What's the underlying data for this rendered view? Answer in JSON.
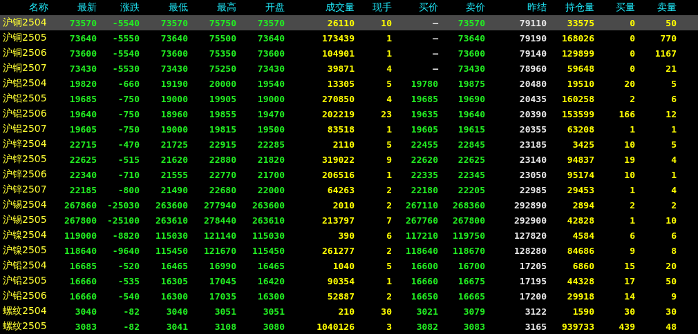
{
  "columns": [
    {
      "label": "名称",
      "kind": "name"
    },
    {
      "label": "最新",
      "kind": "price"
    },
    {
      "label": "涨跌",
      "kind": "price"
    },
    {
      "label": "最低",
      "kind": "price"
    },
    {
      "label": "最高",
      "kind": "price"
    },
    {
      "label": "开盘",
      "kind": "price"
    },
    {
      "label": "成交量",
      "kind": "volume"
    },
    {
      "label": "现手",
      "kind": "volume"
    },
    {
      "label": "买价",
      "kind": "price"
    },
    {
      "label": "卖价",
      "kind": "price"
    },
    {
      "label": "昨结",
      "kind": "settle"
    },
    {
      "label": "持仓量",
      "kind": "volume"
    },
    {
      "label": "买量",
      "kind": "volume"
    },
    {
      "label": "卖量",
      "kind": "volume"
    }
  ],
  "rows": [
    {
      "selected": true,
      "cells": [
        "沪铜2504",
        "73570",
        "-5540",
        "73570",
        "75750",
        "73570",
        "26110",
        "10",
        {
          "text": "—",
          "kind": "empty"
        },
        "73570",
        "79110",
        "33575",
        "0",
        "50"
      ]
    },
    {
      "selected": false,
      "cells": [
        "沪铜2505",
        "73640",
        "-5550",
        "73640",
        "75500",
        "73640",
        "173439",
        "1",
        {
          "text": "—",
          "kind": "empty"
        },
        "73640",
        "79190",
        "168026",
        "0",
        "770"
      ]
    },
    {
      "selected": false,
      "cells": [
        "沪铜2506",
        "73600",
        "-5540",
        "73600",
        "75350",
        "73600",
        "104901",
        "1",
        {
          "text": "—",
          "kind": "empty"
        },
        "73600",
        "79140",
        "129899",
        "0",
        "1167"
      ]
    },
    {
      "selected": false,
      "cells": [
        "沪铜2507",
        "73430",
        "-5530",
        "73430",
        "75250",
        "73430",
        "39871",
        "4",
        {
          "text": "—",
          "kind": "empty"
        },
        "73430",
        "78960",
        "59648",
        "0",
        "21"
      ]
    },
    {
      "selected": false,
      "cells": [
        "沪铝2504",
        "19820",
        "-660",
        "19190",
        "20000",
        "19540",
        "13305",
        "5",
        "19780",
        "19875",
        "20480",
        "19510",
        "20",
        "5"
      ]
    },
    {
      "selected": false,
      "cells": [
        "沪铝2505",
        "19685",
        "-750",
        "19000",
        "19905",
        "19000",
        "270850",
        "4",
        "19685",
        "19690",
        "20435",
        "160258",
        "2",
        "6"
      ]
    },
    {
      "selected": false,
      "cells": [
        "沪铝2506",
        "19640",
        "-750",
        "18960",
        "19855",
        "19470",
        "202219",
        "23",
        "19635",
        "19640",
        "20390",
        "153599",
        "166",
        "12"
      ]
    },
    {
      "selected": false,
      "cells": [
        "沪铝2507",
        "19605",
        "-750",
        "19000",
        "19815",
        "19500",
        "83518",
        "1",
        "19605",
        "19615",
        "20355",
        "63208",
        "1",
        "1"
      ]
    },
    {
      "selected": false,
      "cells": [
        "沪锌2504",
        "22715",
        "-470",
        "21725",
        "22915",
        "22285",
        "2110",
        "5",
        "22455",
        "22845",
        "23185",
        "3425",
        "10",
        "5"
      ]
    },
    {
      "selected": false,
      "cells": [
        "沪锌2505",
        "22625",
        "-515",
        "21620",
        "22880",
        "21820",
        "319022",
        "9",
        "22620",
        "22625",
        "23140",
        "94837",
        "19",
        "4"
      ]
    },
    {
      "selected": false,
      "cells": [
        "沪锌2506",
        "22340",
        "-710",
        "21555",
        "22770",
        "21700",
        "206516",
        "1",
        "22335",
        "22345",
        "23050",
        "95174",
        "10",
        "1"
      ]
    },
    {
      "selected": false,
      "cells": [
        "沪锌2507",
        "22185",
        "-800",
        "21490",
        "22680",
        "22000",
        "64263",
        "2",
        "22180",
        "22205",
        "22985",
        "29453",
        "1",
        "4"
      ]
    },
    {
      "selected": false,
      "cells": [
        "沪锡2504",
        "267860",
        "-25030",
        "263600",
        "277940",
        "263600",
        "2010",
        "2",
        "267110",
        "268360",
        "292890",
        "2894",
        "2",
        "2"
      ]
    },
    {
      "selected": false,
      "cells": [
        "沪锡2505",
        "267800",
        "-25100",
        "263610",
        "278440",
        "263610",
        "213797",
        "7",
        "267760",
        "267800",
        "292900",
        "42828",
        "1",
        "10"
      ]
    },
    {
      "selected": false,
      "cells": [
        "沪镍2504",
        "119000",
        "-8820",
        "115030",
        "121140",
        "115030",
        "390",
        "6",
        "117210",
        "119750",
        "127820",
        "4584",
        "6",
        "6"
      ]
    },
    {
      "selected": false,
      "cells": [
        "沪镍2505",
        "118640",
        "-9640",
        "115450",
        "121670",
        "115450",
        "261277",
        "2",
        "118640",
        "118670",
        "128280",
        "84686",
        "9",
        "8"
      ]
    },
    {
      "selected": false,
      "cells": [
        "沪铅2504",
        "16685",
        "-520",
        "16465",
        "16990",
        "16465",
        "1040",
        "5",
        "16600",
        "16700",
        "17205",
        "6860",
        "15",
        "20"
      ]
    },
    {
      "selected": false,
      "cells": [
        "沪铅2505",
        "16660",
        "-535",
        "16305",
        "17045",
        "16420",
        "90354",
        "1",
        "16660",
        "16675",
        "17195",
        "44328",
        "17",
        "50"
      ]
    },
    {
      "selected": false,
      "cells": [
        "沪铅2506",
        "16660",
        "-540",
        "16300",
        "17035",
        "16300",
        "52887",
        "2",
        "16650",
        "16665",
        "17200",
        "29918",
        "14",
        "9"
      ]
    },
    {
      "selected": false,
      "cells": [
        "螺纹2504",
        "3040",
        "-82",
        "3040",
        "3051",
        "3051",
        "210",
        "30",
        "3021",
        "3079",
        "3122",
        "1590",
        "30",
        "30"
      ]
    },
    {
      "selected": false,
      "cells": [
        "螺纹2505",
        "3083",
        "-82",
        "3041",
        "3108",
        "3080",
        "1040126",
        "3",
        "3082",
        "3083",
        "3165",
        "939733",
        "439",
        "48"
      ]
    }
  ]
}
